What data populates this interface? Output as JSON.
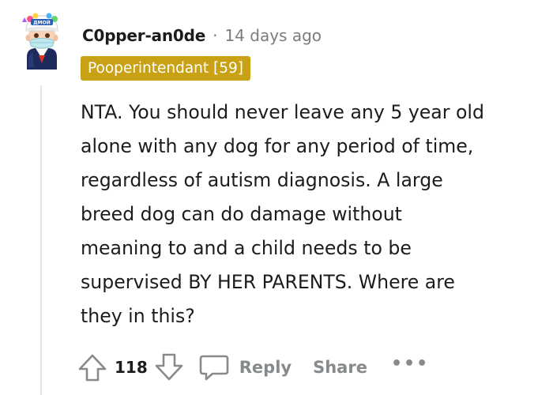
{
  "comment": {
    "username": "C0pper-an0de",
    "separator": "·",
    "timestamp": "14 days ago",
    "flair": "Pooperintendant [59]",
    "body_lines": [
      "NTA. You should never leave any 5 year old",
      "alone with any dog for any period of time,",
      "regardless of autism diagnosis. A large",
      "breed dog can do damage without",
      "meaning to and a child needs to be",
      "supervised BY HER PARENTS. Where are",
      "they in this?"
    ],
    "score": "118",
    "reply_label": "Reply",
    "share_label": "Share",
    "more_label": "•••"
  },
  "avatar": {
    "hat_text": "ДМОЙ"
  },
  "colors": {
    "flair_bg": "#c9a114",
    "muted": "#7c7c7c",
    "action": "#878a8c",
    "text": "#1c1c1c"
  },
  "icons": {
    "upvote": "arrow-up-icon",
    "downvote": "arrow-down-icon",
    "reply": "speech-bubble-icon",
    "more": "ellipsis-icon"
  }
}
